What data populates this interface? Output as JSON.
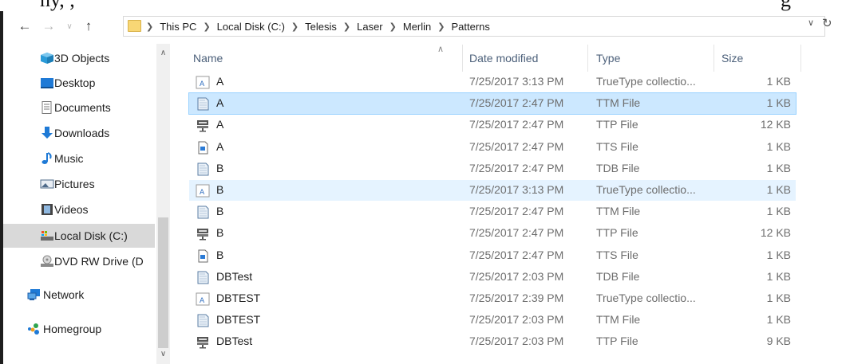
{
  "top_fragment": {
    "left": "ny, ,",
    "right": "g"
  },
  "nav": {
    "back_icon": "arrow-left-icon",
    "forward_icon": "arrow-right-icon",
    "recent_icon": "chevron-down-icon",
    "up_icon": "arrow-up-icon",
    "refresh_icon": "refresh-icon"
  },
  "address": {
    "crumbs": [
      "This PC",
      "Local Disk (C:)",
      "Telesis",
      "Laser",
      "Merlin",
      "Patterns"
    ]
  },
  "sidebar": {
    "items": [
      {
        "label": "3D Objects",
        "icon": "cube-icon",
        "color": "#2b9bd8"
      },
      {
        "label": "Desktop",
        "icon": "desktop-icon",
        "color": "#1f7ad6"
      },
      {
        "label": "Documents",
        "icon": "documents-icon",
        "color": "#7a7a7a"
      },
      {
        "label": "Downloads",
        "icon": "download-arrow-icon",
        "color": "#1f7ad6"
      },
      {
        "label": "Music",
        "icon": "music-note-icon",
        "color": "#1f7ad6"
      },
      {
        "label": "Pictures",
        "icon": "pictures-icon",
        "color": "#4f6b8a"
      },
      {
        "label": "Videos",
        "icon": "film-icon",
        "color": "#444444"
      },
      {
        "label": "Local Disk (C:)",
        "icon": "local-disk-icon",
        "color": "#6b6b6b",
        "selected": true
      },
      {
        "label": "DVD RW Drive (D",
        "icon": "dvd-drive-icon",
        "color": "#8a8a8a"
      },
      {
        "label": "Network",
        "icon": "network-icon",
        "color": "#1f7ad6"
      },
      {
        "label": "Homegroup",
        "icon": "homegroup-icon",
        "color": "#2ea44f"
      }
    ]
  },
  "columns": {
    "name": "Name",
    "date": "Date modified",
    "type": "Type",
    "size": "Size"
  },
  "files": [
    {
      "name": "A",
      "date": "7/25/2017 3:13 PM",
      "type": "TrueType collectio...",
      "size": "1 KB",
      "icon": "truetype-font-file-icon"
    },
    {
      "name": "A",
      "date": "7/25/2017 2:47 PM",
      "type": "TTM File",
      "size": "1 KB",
      "icon": "generic-file-icon",
      "selected": true
    },
    {
      "name": "A",
      "date": "7/25/2017 2:47 PM",
      "type": "TTP File",
      "size": "12 KB",
      "icon": "ttp-file-icon"
    },
    {
      "name": "A",
      "date": "7/25/2017 2:47 PM",
      "type": "TTS File",
      "size": "1 KB",
      "icon": "text-file-icon"
    },
    {
      "name": "B",
      "date": "7/25/2017 2:47 PM",
      "type": "TDB File",
      "size": "1 KB",
      "icon": "generic-file-icon"
    },
    {
      "name": "B",
      "date": "7/25/2017 3:13 PM",
      "type": "TrueType collectio...",
      "size": "1 KB",
      "icon": "truetype-font-file-icon",
      "hover": true
    },
    {
      "name": "B",
      "date": "7/25/2017 2:47 PM",
      "type": "TTM File",
      "size": "1 KB",
      "icon": "generic-file-icon"
    },
    {
      "name": "B",
      "date": "7/25/2017 2:47 PM",
      "type": "TTP File",
      "size": "12 KB",
      "icon": "ttp-file-icon"
    },
    {
      "name": "B",
      "date": "7/25/2017 2:47 PM",
      "type": "TTS File",
      "size": "1 KB",
      "icon": "text-file-icon"
    },
    {
      "name": "DBTest",
      "date": "7/25/2017 2:03 PM",
      "type": "TDB File",
      "size": "1 KB",
      "icon": "generic-file-icon"
    },
    {
      "name": "DBTEST",
      "date": "7/25/2017 2:39 PM",
      "type": "TrueType collectio...",
      "size": "1 KB",
      "icon": "truetype-font-file-icon"
    },
    {
      "name": "DBTEST",
      "date": "7/25/2017 2:03 PM",
      "type": "TTM File",
      "size": "1 KB",
      "icon": "generic-file-icon"
    },
    {
      "name": "DBTest",
      "date": "7/25/2017 2:03 PM",
      "type": "TTP File",
      "size": "9 KB",
      "icon": "ttp-file-icon"
    }
  ],
  "colors": {
    "selection": "#cce8ff",
    "selection_border": "#99d1ff",
    "hover": "#e5f3ff",
    "header_text": "#4c607a"
  }
}
